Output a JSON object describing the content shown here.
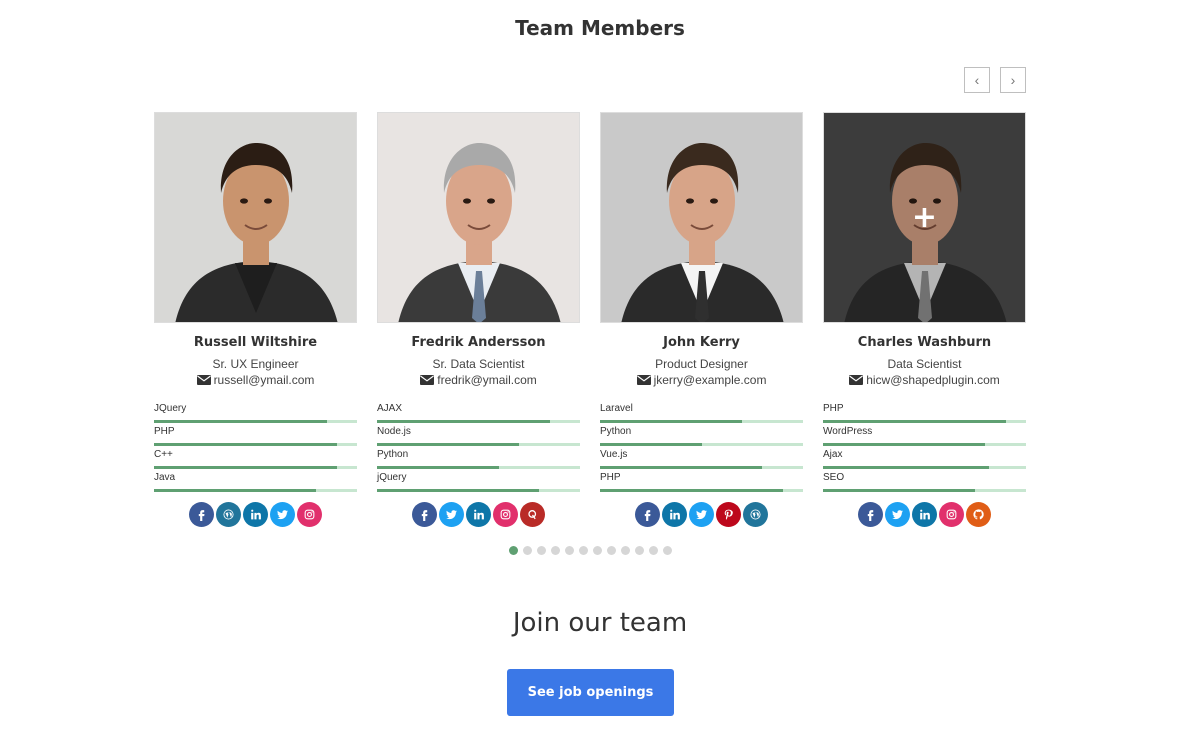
{
  "page": {
    "title": "Team Members",
    "prev_glyph": "‹",
    "next_glyph": "›"
  },
  "colors": {
    "skill_fill": "#5fa072",
    "skill_track": "#c7e6d0",
    "facebook": "#3b5998",
    "wordpress": "#21759b",
    "linkedin": "#0e76a8",
    "twitter": "#1da1f2",
    "instagram": "#e1306c",
    "quora": "#b92b27",
    "pinterest": "#bd081c",
    "github": "#e05d16",
    "cta": "#3b78e7"
  },
  "members": [
    {
      "name": "Russell Wiltshire",
      "job": "Sr. UX Engineer",
      "email": "russell@ymail.com",
      "photo_bg": "#d8d8d6",
      "skills": [
        {
          "label": "JQuery",
          "level": 85
        },
        {
          "label": "PHP",
          "level": 90
        },
        {
          "label": "C++",
          "level": 90
        },
        {
          "label": "Java",
          "level": 80
        }
      ],
      "socials": [
        "facebook",
        "wordpress",
        "linkedin",
        "twitter",
        "instagram"
      ]
    },
    {
      "name": "Fredrik Andersson",
      "job": "Sr. Data Scientist",
      "email": "fredrik@ymail.com",
      "photo_bg": "#e8e4e2",
      "skills": [
        {
          "label": "AJAX",
          "level": 85
        },
        {
          "label": "Node.js",
          "level": 70
        },
        {
          "label": "Python",
          "level": 60
        },
        {
          "label": "jQuery",
          "level": 80
        }
      ],
      "socials": [
        "facebook",
        "twitter",
        "linkedin",
        "instagram",
        "quora"
      ]
    },
    {
      "name": "John Kerry",
      "job": "Product Designer",
      "email": "jkerry@example.com",
      "photo_bg": "#c9c9c9",
      "skills": [
        {
          "label": "Laravel",
          "level": 70
        },
        {
          "label": "Python",
          "level": 50
        },
        {
          "label": "Vue.js",
          "level": 80
        },
        {
          "label": "PHP",
          "level": 90
        }
      ],
      "socials": [
        "facebook",
        "linkedin",
        "twitter",
        "pinterest",
        "wordpress"
      ]
    },
    {
      "name": "Charles Washburn",
      "job": "Data Scientist",
      "email": "hicw@shapedplugin.com",
      "photo_bg": "#4a4a4a",
      "hover": true,
      "skills": [
        {
          "label": "PHP",
          "level": 90
        },
        {
          "label": "WordPress",
          "level": 80
        },
        {
          "label": "Ajax",
          "level": 82
        },
        {
          "label": "SEO",
          "level": 75
        }
      ],
      "socials": [
        "facebook",
        "twitter",
        "linkedin",
        "instagram",
        "github"
      ]
    }
  ],
  "pagination": {
    "count": 12,
    "active_index": 0
  },
  "join": {
    "title": "Join our team",
    "button_label": "See job openings"
  }
}
